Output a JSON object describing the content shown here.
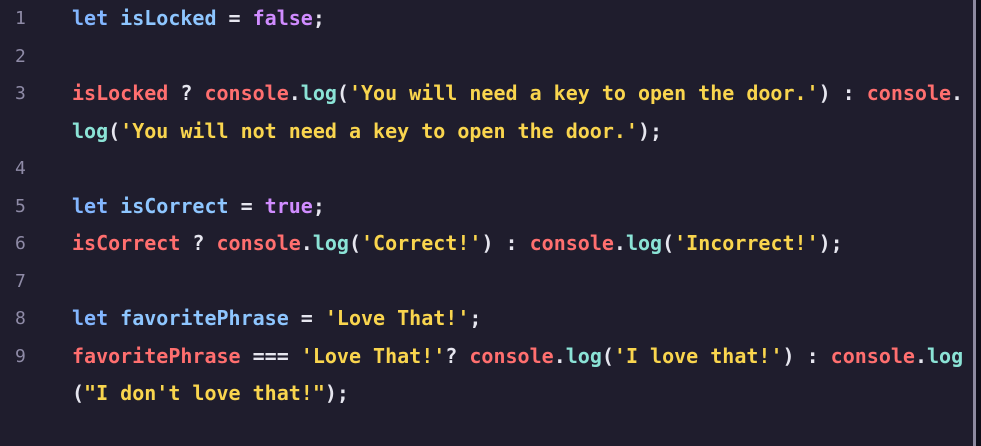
{
  "editor": {
    "lines": [
      {
        "number": "1",
        "tokens": [
          {
            "t": "let",
            "c": "kw"
          },
          {
            "t": " ",
            "c": "op"
          },
          {
            "t": "isLocked",
            "c": "id"
          },
          {
            "t": " = ",
            "c": "op"
          },
          {
            "t": "false",
            "c": "bool"
          },
          {
            "t": ";",
            "c": "punc"
          }
        ]
      },
      {
        "number": "2",
        "tokens": []
      },
      {
        "number": "3",
        "tokens": [
          {
            "t": "isLocked",
            "c": "obj"
          },
          {
            "t": " ? ",
            "c": "op"
          },
          {
            "t": "console",
            "c": "obj"
          },
          {
            "t": ".",
            "c": "punc"
          },
          {
            "t": "log",
            "c": "fn"
          },
          {
            "t": "(",
            "c": "punc"
          },
          {
            "t": "'You will need a key to open the door.'",
            "c": "str"
          },
          {
            "t": ") : ",
            "c": "op"
          },
          {
            "t": "console",
            "c": "obj"
          },
          {
            "t": ".",
            "c": "punc"
          }
        ]
      },
      {
        "number": "",
        "tokens": [
          {
            "t": "log",
            "c": "fn"
          },
          {
            "t": "(",
            "c": "punc"
          },
          {
            "t": "'You will not need a key to open the door.'",
            "c": "str"
          },
          {
            "t": ");",
            "c": "punc"
          }
        ]
      },
      {
        "number": "4",
        "tokens": []
      },
      {
        "number": "5",
        "tokens": [
          {
            "t": "let",
            "c": "kw"
          },
          {
            "t": " ",
            "c": "op"
          },
          {
            "t": "isCorrect",
            "c": "id"
          },
          {
            "t": " = ",
            "c": "op"
          },
          {
            "t": "true",
            "c": "bool"
          },
          {
            "t": ";",
            "c": "punc"
          }
        ]
      },
      {
        "number": "6",
        "tokens": [
          {
            "t": "isCorrect",
            "c": "obj"
          },
          {
            "t": " ? ",
            "c": "op"
          },
          {
            "t": "console",
            "c": "obj"
          },
          {
            "t": ".",
            "c": "punc"
          },
          {
            "t": "log",
            "c": "fn"
          },
          {
            "t": "(",
            "c": "punc"
          },
          {
            "t": "'Correct!'",
            "c": "str"
          },
          {
            "t": ") : ",
            "c": "op"
          },
          {
            "t": "console",
            "c": "obj"
          },
          {
            "t": ".",
            "c": "punc"
          },
          {
            "t": "log",
            "c": "fn"
          },
          {
            "t": "(",
            "c": "punc"
          },
          {
            "t": "'Incorrect!'",
            "c": "str"
          },
          {
            "t": ");",
            "c": "punc"
          }
        ]
      },
      {
        "number": "7",
        "tokens": []
      },
      {
        "number": "8",
        "tokens": [
          {
            "t": "let",
            "c": "kw"
          },
          {
            "t": " ",
            "c": "op"
          },
          {
            "t": "favoritePhrase",
            "c": "id"
          },
          {
            "t": " = ",
            "c": "op"
          },
          {
            "t": "'Love That!'",
            "c": "str"
          },
          {
            "t": ";",
            "c": "punc"
          }
        ]
      },
      {
        "number": "9",
        "tokens": [
          {
            "t": "favoritePhrase",
            "c": "obj"
          },
          {
            "t": " === ",
            "c": "op"
          },
          {
            "t": "'Love That!'",
            "c": "str"
          },
          {
            "t": "? ",
            "c": "op"
          },
          {
            "t": "console",
            "c": "obj"
          },
          {
            "t": ".",
            "c": "punc"
          },
          {
            "t": "log",
            "c": "fn"
          },
          {
            "t": "(",
            "c": "punc"
          },
          {
            "t": "'I love that!'",
            "c": "str"
          },
          {
            "t": ") : ",
            "c": "op"
          },
          {
            "t": "console",
            "c": "obj"
          },
          {
            "t": ".",
            "c": "punc"
          },
          {
            "t": "log",
            "c": "fn"
          }
        ]
      },
      {
        "number": "",
        "tokens": [
          {
            "t": "(",
            "c": "punc"
          },
          {
            "t": "\"I don't love that!\"",
            "c": "str"
          },
          {
            "t": ");",
            "c": "punc"
          }
        ]
      }
    ]
  },
  "colors": {
    "background": "#1f1d2d",
    "keyword": "#83b6ff",
    "string": "#f9d54e",
    "function": "#8be3d6",
    "object": "#ff6f6f",
    "boolean": "#d08cff",
    "line_number": "#8f8ba7"
  }
}
